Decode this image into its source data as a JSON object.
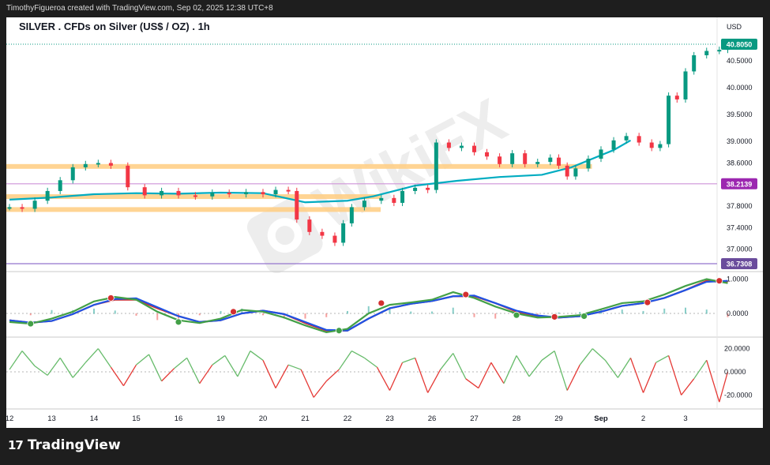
{
  "header": {
    "credit": "TimothyFigueroa created with TradingView.com, Sep 02, 2025 12:38 UTC+8"
  },
  "footer": {
    "brand_name": "TradingView",
    "brand_logo": "17"
  },
  "chart_data": [
    {
      "type": "candlestick",
      "title": "SILVER . CFDs on Silver (US$ / OZ) . 1h",
      "currency": "USD",
      "y_ticks": [
        40.5,
        40.0,
        39.5,
        39.0,
        38.6,
        37.8,
        37.4,
        37.0
      ],
      "y_tick_labels": [
        "40.5000",
        "40.0000",
        "39.5000",
        "39.0000",
        "38.6000",
        "37.8000",
        "37.4000",
        "37.0000"
      ],
      "ylim": [
        36.73,
        40.9
      ],
      "x_ticks": [
        "12",
        "13",
        "14",
        "15",
        "16",
        "19",
        "20",
        "21",
        "22",
        "23",
        "26",
        "27",
        "28",
        "29",
        "Sep",
        "2",
        "3"
      ],
      "price_labels": [
        {
          "value": 40.805,
          "text": "40.8050",
          "color": "#089981"
        },
        {
          "value": 38.2139,
          "text": "38.2139",
          "color": "#9c27b0"
        },
        {
          "value": 36.7308,
          "text": "36.7308",
          "color": "#6a4c9c"
        }
      ],
      "horizontal_lines": [
        {
          "value": 38.2139,
          "color": "#ce93d8"
        },
        {
          "value": 36.7308,
          "color": "#9575cd"
        }
      ],
      "zones": [
        {
          "from": 38.51,
          "to": 38.58,
          "x_start": "12",
          "x_end": "29"
        },
        {
          "from": 37.96,
          "to": 38.02,
          "x_start": "12",
          "x_end": "22"
        },
        {
          "from": 37.72,
          "to": 37.78,
          "x_start": "12",
          "x_end": "22"
        }
      ],
      "moving_average": [
        {
          "x": 0,
          "y": 37.92
        },
        {
          "x": 1,
          "y": 37.96
        },
        {
          "x": 2,
          "y": 38.02
        },
        {
          "x": 3,
          "y": 38.04
        },
        {
          "x": 4,
          "y": 38.03
        },
        {
          "x": 5,
          "y": 38.05
        },
        {
          "x": 6,
          "y": 38.04
        },
        {
          "x": 7,
          "y": 37.87
        },
        {
          "x": 8,
          "y": 37.9
        },
        {
          "x": 8.6,
          "y": 37.98
        },
        {
          "x": 9.6,
          "y": 38.18
        },
        {
          "x": 10.6,
          "y": 38.27
        },
        {
          "x": 11.6,
          "y": 38.34
        },
        {
          "x": 12.6,
          "y": 38.38
        },
        {
          "x": 13.3,
          "y": 38.52
        },
        {
          "x": 14.3,
          "y": 38.84
        },
        {
          "x": 14.7,
          "y": 39.02
        }
      ],
      "close": [
        {
          "x": 0,
          "y": 37.78
        },
        {
          "x": 0.3,
          "y": 37.75
        },
        {
          "x": 0.6,
          "y": 37.9
        },
        {
          "x": 0.9,
          "y": 38.08
        },
        {
          "x": 1.2,
          "y": 38.28
        },
        {
          "x": 1.5,
          "y": 38.52
        },
        {
          "x": 1.8,
          "y": 38.58
        },
        {
          "x": 2.1,
          "y": 38.6
        },
        {
          "x": 2.4,
          "y": 38.55
        },
        {
          "x": 2.8,
          "y": 38.15
        },
        {
          "x": 3.2,
          "y": 38.0
        },
        {
          "x": 3.6,
          "y": 38.08
        },
        {
          "x": 4.0,
          "y": 38.0
        },
        {
          "x": 4.4,
          "y": 37.98
        },
        {
          "x": 4.8,
          "y": 38.05
        },
        {
          "x": 5.2,
          "y": 38.02
        },
        {
          "x": 5.6,
          "y": 38.06
        },
        {
          "x": 6.0,
          "y": 38.02
        },
        {
          "x": 6.3,
          "y": 38.1
        },
        {
          "x": 6.6,
          "y": 38.08
        },
        {
          "x": 6.8,
          "y": 37.55
        },
        {
          "x": 7.1,
          "y": 37.32
        },
        {
          "x": 7.4,
          "y": 37.25
        },
        {
          "x": 7.7,
          "y": 37.12
        },
        {
          "x": 7.9,
          "y": 37.48
        },
        {
          "x": 8.1,
          "y": 37.78
        },
        {
          "x": 8.4,
          "y": 37.9
        },
        {
          "x": 8.8,
          "y": 37.95
        },
        {
          "x": 9.1,
          "y": 37.86
        },
        {
          "x": 9.3,
          "y": 38.08
        },
        {
          "x": 9.6,
          "y": 38.14
        },
        {
          "x": 9.9,
          "y": 38.1
        },
        {
          "x": 10.1,
          "y": 38.98
        },
        {
          "x": 10.4,
          "y": 38.88
        },
        {
          "x": 10.7,
          "y": 38.92
        },
        {
          "x": 11.0,
          "y": 38.8
        },
        {
          "x": 11.3,
          "y": 38.72
        },
        {
          "x": 11.6,
          "y": 38.58
        },
        {
          "x": 11.9,
          "y": 38.78
        },
        {
          "x": 12.2,
          "y": 38.58
        },
        {
          "x": 12.5,
          "y": 38.62
        },
        {
          "x": 12.8,
          "y": 38.7
        },
        {
          "x": 13.0,
          "y": 38.55
        },
        {
          "x": 13.2,
          "y": 38.35
        },
        {
          "x": 13.4,
          "y": 38.5
        },
        {
          "x": 13.7,
          "y": 38.68
        },
        {
          "x": 14.0,
          "y": 38.85
        },
        {
          "x": 14.3,
          "y": 39.02
        },
        {
          "x": 14.6,
          "y": 39.1
        },
        {
          "x": 14.9,
          "y": 38.98
        },
        {
          "x": 15.2,
          "y": 38.88
        },
        {
          "x": 15.4,
          "y": 38.95
        },
        {
          "x": 15.6,
          "y": 39.85
        },
        {
          "x": 15.8,
          "y": 39.78
        },
        {
          "x": 16.0,
          "y": 40.3
        },
        {
          "x": 16.2,
          "y": 40.6
        },
        {
          "x": 16.5,
          "y": 40.68
        },
        {
          "x": 16.8,
          "y": 40.7
        },
        {
          "x": 17.0,
          "y": 40.805
        }
      ]
    },
    {
      "type": "line",
      "name": "oscillator-1",
      "y_tick_labels": [
        "1.0000",
        "0.0000"
      ],
      "ylim": [
        -0.75,
        1.1
      ],
      "x": [
        0,
        0.5,
        1,
        1.5,
        2,
        2.5,
        3,
        3.5,
        4,
        4.5,
        5,
        5.5,
        6,
        6.5,
        7,
        7.5,
        8,
        8.5,
        9,
        9.5,
        10,
        10.5,
        11,
        11.5,
        12,
        12.5,
        13,
        13.5,
        14,
        14.5,
        15,
        15.5,
        16,
        16.5,
        17
      ],
      "series": [
        {
          "color": "#43a047",
          "values": [
            -0.25,
            -0.3,
            -0.15,
            0.05,
            0.35,
            0.48,
            0.4,
            0.05,
            -0.2,
            -0.28,
            -0.15,
            0.1,
            0.05,
            -0.12,
            -0.35,
            -0.55,
            -0.45,
            0.0,
            0.25,
            0.32,
            0.4,
            0.62,
            0.45,
            0.2,
            0.0,
            -0.12,
            -0.1,
            -0.05,
            0.12,
            0.3,
            0.35,
            0.55,
            0.8,
            1.0,
            0.88
          ]
        },
        {
          "color": "#1e53e5",
          "values": [
            -0.2,
            -0.27,
            -0.22,
            -0.02,
            0.25,
            0.42,
            0.44,
            0.18,
            -0.08,
            -0.25,
            -0.2,
            0.0,
            0.08,
            -0.02,
            -0.25,
            -0.48,
            -0.5,
            -0.15,
            0.15,
            0.28,
            0.36,
            0.5,
            0.52,
            0.3,
            0.08,
            -0.06,
            -0.12,
            -0.08,
            0.05,
            0.22,
            0.3,
            0.45,
            0.68,
            0.92,
            0.95
          ]
        },
        {
          "color": "#d32f2f",
          "values": [
            -0.2,
            -0.27,
            -0.22,
            -0.02,
            0.25,
            0.4,
            0.4,
            0.15,
            -0.08,
            -0.25,
            -0.2,
            0.0,
            0.08,
            -0.02,
            -0.28,
            -0.5,
            -0.5,
            -0.15,
            0.15,
            0.28,
            0.36,
            0.5,
            0.5,
            0.3,
            0.05,
            -0.08,
            -0.12,
            -0.08,
            0.05,
            0.22,
            0.3,
            0.45,
            0.68,
            0.95,
            0.9
          ]
        }
      ],
      "markers": [
        {
          "x": 0.5,
          "y": -0.3,
          "color": "#43a047"
        },
        {
          "x": 2.4,
          "y": 0.45,
          "color": "#d32f2f"
        },
        {
          "x": 4.0,
          "y": -0.25,
          "color": "#43a047"
        },
        {
          "x": 5.3,
          "y": 0.05,
          "color": "#d32f2f"
        },
        {
          "x": 7.8,
          "y": -0.5,
          "color": "#43a047"
        },
        {
          "x": 8.8,
          "y": 0.3,
          "color": "#d32f2f"
        },
        {
          "x": 10.8,
          "y": 0.55,
          "color": "#d32f2f"
        },
        {
          "x": 12.0,
          "y": -0.05,
          "color": "#43a047"
        },
        {
          "x": 12.9,
          "y": -0.1,
          "color": "#d32f2f"
        },
        {
          "x": 13.6,
          "y": -0.08,
          "color": "#43a047"
        },
        {
          "x": 15.1,
          "y": 0.32,
          "color": "#d32f2f"
        },
        {
          "x": 16.8,
          "y": 0.95,
          "color": "#d32f2f"
        }
      ]
    },
    {
      "type": "line",
      "name": "oscillator-2",
      "y_tick_labels": [
        "20.0000",
        "0.0000",
        "-20.0000"
      ],
      "ylim": [
        -28,
        24
      ],
      "x": [
        0,
        0.3,
        0.6,
        0.9,
        1.2,
        1.5,
        1.8,
        2.1,
        2.4,
        2.7,
        3.0,
        3.3,
        3.6,
        3.9,
        4.2,
        4.5,
        4.8,
        5.1,
        5.4,
        5.7,
        6.0,
        6.3,
        6.6,
        6.9,
        7.2,
        7.5,
        7.8,
        8.1,
        8.4,
        8.7,
        9.0,
        9.3,
        9.6,
        9.9,
        10.2,
        10.5,
        10.8,
        11.1,
        11.4,
        11.7,
        12.0,
        12.3,
        12.6,
        12.9,
        13.2,
        13.5,
        13.8,
        14.1,
        14.4,
        14.7,
        15.0,
        15.3,
        15.6,
        15.9,
        16.2,
        16.5,
        16.8,
        17.0
      ],
      "values": [
        2,
        18,
        5,
        -3,
        12,
        -5,
        8,
        20,
        4,
        -12,
        6,
        15,
        -8,
        3,
        12,
        -10,
        6,
        14,
        -4,
        18,
        10,
        -14,
        6,
        2,
        -22,
        -8,
        2,
        18,
        12,
        4,
        -16,
        8,
        12,
        -18,
        2,
        16,
        -6,
        -14,
        8,
        -10,
        14,
        -4,
        10,
        18,
        -16,
        6,
        20,
        10,
        -5,
        12,
        -18,
        8,
        14,
        -20,
        -6,
        10,
        -26,
        0
      ]
    }
  ]
}
